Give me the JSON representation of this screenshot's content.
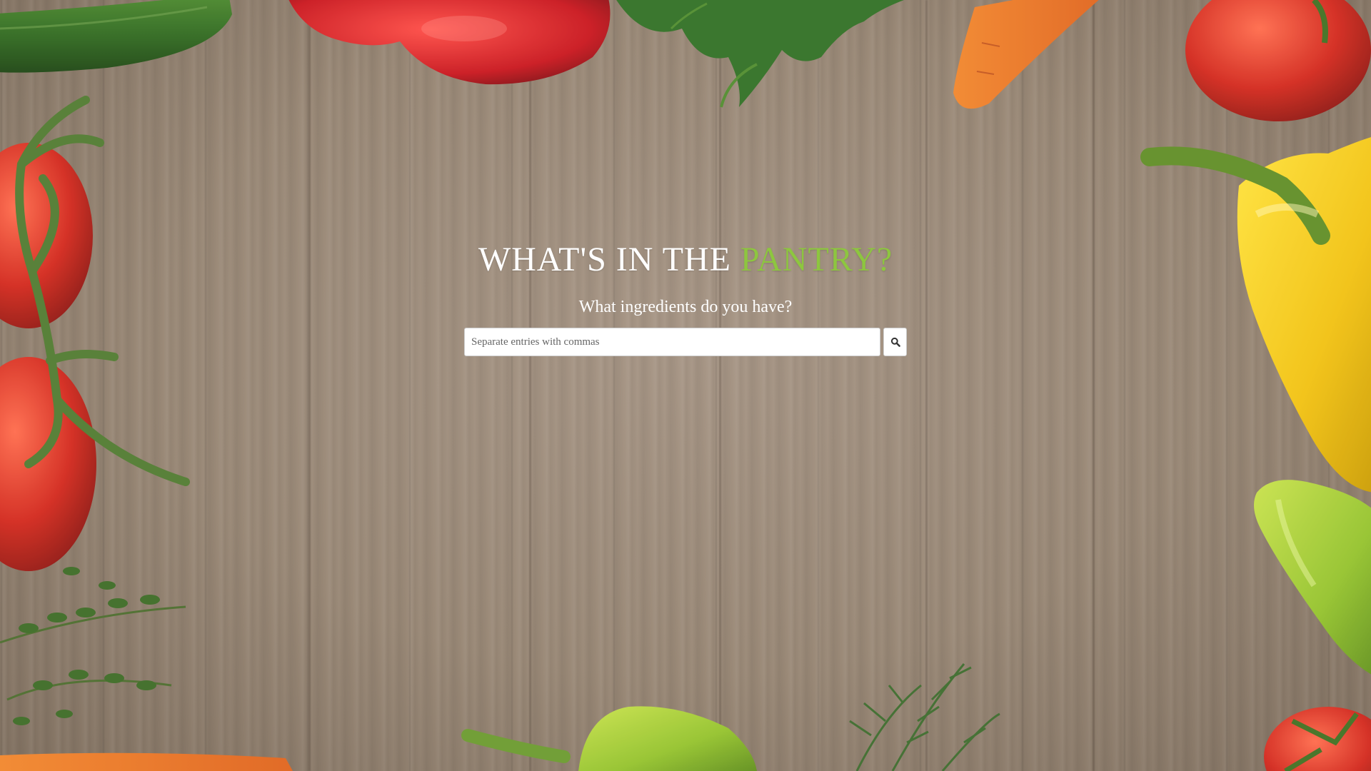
{
  "hero": {
    "title_main": "WHAT'S IN THE ",
    "title_accent": "PANTRY?",
    "subtitle": "What ingredients do you have?"
  },
  "search": {
    "value": "",
    "placeholder": "Separate entries with commas",
    "button_icon": "search-icon"
  },
  "colors": {
    "accent": "#8dc63f",
    "title_text": "#ffffff",
    "wood": "#9a8876"
  },
  "background": {
    "scene": "wooden table surrounded by fresh vegetables",
    "items": [
      "cucumber",
      "red bell pepper",
      "parsley",
      "carrot",
      "tomato",
      "yellow bell pepper",
      "green pepper",
      "tomatoes on vine",
      "thyme",
      "rosemary",
      "yellow-green bell pepper"
    ]
  }
}
